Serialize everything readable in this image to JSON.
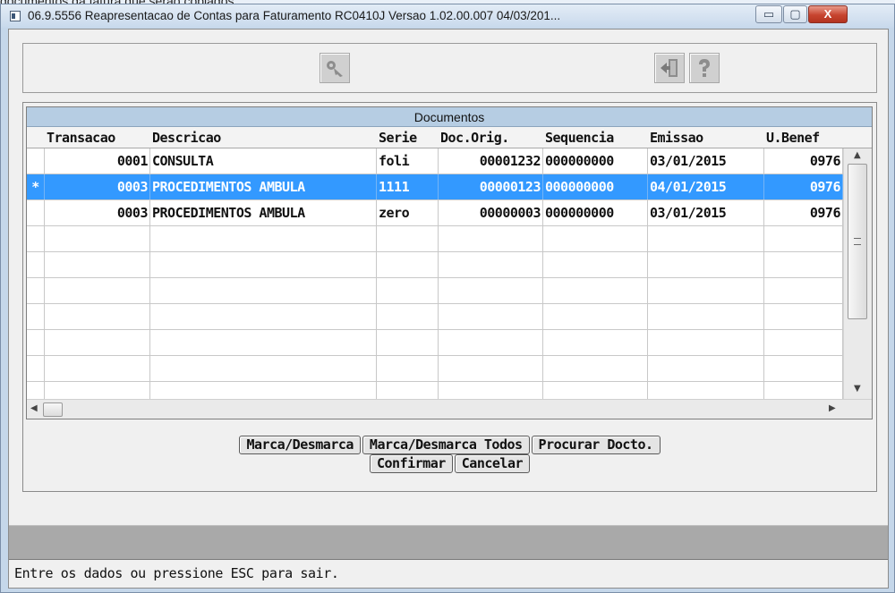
{
  "background": {
    "caption": "documentos da fatura que serão copiados."
  },
  "window": {
    "title": "06.9.5556  Reapresentacao de Contas para Faturamento RC0410J Versao 1.02.00.007 04/03/201...",
    "minimize": "▭",
    "maximize": "▢",
    "close": "X"
  },
  "grid": {
    "title": "Documentos",
    "columns": [
      "Transacao",
      "Descricao",
      "Serie",
      "Doc.Orig.",
      "Sequencia",
      "Emissao",
      "U.Benef"
    ],
    "rows": [
      {
        "mark": "",
        "transacao": "0001",
        "descricao": "CONSULTA",
        "serie": "foli",
        "doc_orig": "00001232",
        "sequencia": "000000000",
        "emissao": "03/01/2015",
        "u_benef": "0976"
      },
      {
        "mark": "*",
        "transacao": "0003",
        "descricao": "PROCEDIMENTOS AMBULA",
        "serie": "1111",
        "doc_orig": "00000123",
        "sequencia": "000000000",
        "emissao": "04/01/2015",
        "u_benef": "0976"
      },
      {
        "mark": "",
        "transacao": "0003",
        "descricao": "PROCEDIMENTOS AMBULA",
        "serie": "zero",
        "doc_orig": "00000003",
        "sequencia": "000000000",
        "emissao": "03/01/2015",
        "u_benef": "0976"
      }
    ],
    "selected_row": 1
  },
  "buttons": {
    "marca_desmarca": "Marca/Desmarca",
    "marca_desmarca_todos": "Marca/Desmarca Todos",
    "procurar": "Procurar Docto.",
    "confirmar": "Confirmar",
    "cancelar": "Cancelar"
  },
  "status": {
    "message": "Entre os dados ou pressione ESC para sair."
  }
}
